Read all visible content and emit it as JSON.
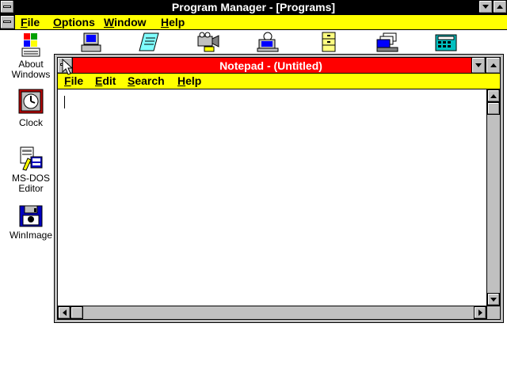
{
  "program_manager": {
    "title": "Program Manager - [Programs]",
    "menu": [
      {
        "label": "File",
        "acc": "F",
        "rest": "ile"
      },
      {
        "label": "Options",
        "acc": "O",
        "rest": "ptions"
      },
      {
        "label": "Window",
        "acc": "W",
        "rest": "indow"
      },
      {
        "label": "Help",
        "acc": "H",
        "rest": "elp"
      }
    ]
  },
  "desktop_icons": [
    {
      "label_line1": "About",
      "label_line2": "Windows",
      "icon": "windows-logo-icon"
    },
    {
      "label_line1": "Clock",
      "label_line2": "",
      "icon": "clock-icon"
    },
    {
      "label_line1": "MS-DOS",
      "label_line2": "Editor",
      "icon": "msdos-editor-icon"
    },
    {
      "label_line1": "WinImage",
      "label_line2": "",
      "icon": "winimage-icon"
    }
  ],
  "notepad": {
    "title": "Notepad - (Untitled)",
    "menu": [
      {
        "label": "File",
        "acc": "F",
        "rest": "ile"
      },
      {
        "label": "Edit",
        "acc": "E",
        "rest": "dit"
      },
      {
        "label": "Search",
        "acc": "S",
        "rest": "earch"
      },
      {
        "label": "Help",
        "acc": "H",
        "rest": "elp"
      }
    ],
    "text": ""
  },
  "colors": {
    "titlebar_active": "#ff0000",
    "titlebar_inactive": "#000000",
    "menubar": "#ffff00"
  }
}
